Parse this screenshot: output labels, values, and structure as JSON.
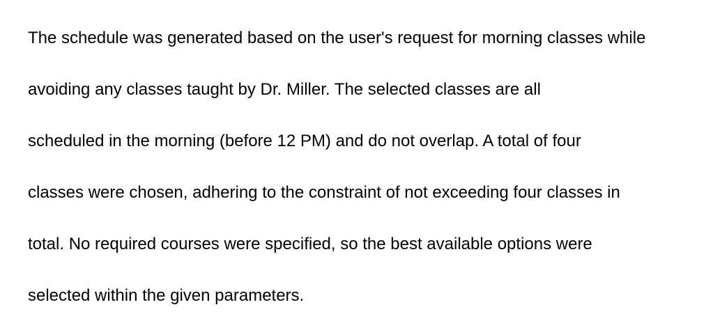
{
  "document": {
    "lines": [
      "The schedule was generated based on the user's request for morning classes while",
      "avoiding any classes taught by Dr. Miller. The selected classes are all",
      "scheduled in the morning (before 12 PM) and do not overlap. A total of four",
      "classes were chosen, adhering to the constraint of not exceeding four classes in",
      "total. No required courses were specified, so the best available options were",
      "selected within the given parameters."
    ]
  }
}
